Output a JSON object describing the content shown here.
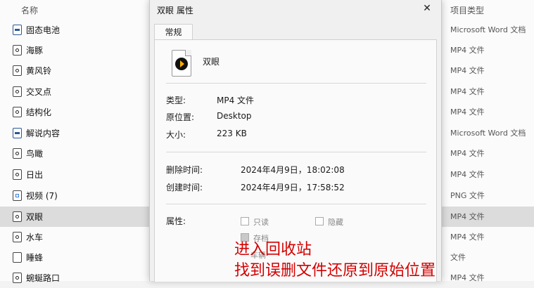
{
  "explorer": {
    "header_name": "名称",
    "header_type": "项目类型",
    "rows": [
      {
        "name": "固态电池",
        "type": "Microsoft Word 文档",
        "icon": "word-doc-icon"
      },
      {
        "name": "海豚",
        "type": "MP4 文件",
        "icon": "video-file-icon"
      },
      {
        "name": "黄风铃",
        "type": "MP4 文件",
        "icon": "video-file-icon"
      },
      {
        "name": "交叉点",
        "type": "MP4 文件",
        "icon": "video-file-icon"
      },
      {
        "name": "结构化",
        "type": "MP4 文件",
        "icon": "video-file-icon"
      },
      {
        "name": "解说内容",
        "type": "Microsoft Word 文档",
        "icon": "word-doc-icon"
      },
      {
        "name": "鸟瞰",
        "type": "MP4 文件",
        "icon": "video-file-icon"
      },
      {
        "name": "日出",
        "type": "MP4 文件",
        "icon": "video-file-icon"
      },
      {
        "name": "视频 (7)",
        "type": "PNG 文件",
        "icon": "image-file-icon"
      },
      {
        "name": "双眼",
        "type": "MP4 文件",
        "icon": "video-file-icon",
        "selected": true
      },
      {
        "name": "水车",
        "type": "MP4 文件",
        "icon": "video-file-icon"
      },
      {
        "name": "睡蜂",
        "type": "文件",
        "icon": "blank-file-icon"
      },
      {
        "name": "蜿蜒路口",
        "type": "MP4 文件",
        "icon": "video-file-icon"
      }
    ]
  },
  "dialog": {
    "title": "双眼 属性",
    "close_glyph": "✕",
    "tab_label": "常规",
    "file_name": "双眼",
    "props": [
      {
        "label": "类型:",
        "value": "MP4 文件"
      },
      {
        "label": "原位置:",
        "value": "Desktop"
      },
      {
        "label": "大小:",
        "value": "223 KB"
      }
    ],
    "times": [
      {
        "label": "删除时间:",
        "value": "2024年4月9日，18:02:08"
      },
      {
        "label": "创建时间:",
        "value": "2024年4月9日，17:58:52"
      }
    ],
    "attributes_label": "属性:",
    "readonly_label": "只读",
    "hidden_label": "隐藏",
    "archive_label": "存档",
    "extra_label": "车辆"
  },
  "overlay": {
    "line1": "进入回收站",
    "line2": "找到误删文件还原到原始位置",
    "color": "#d40000"
  }
}
